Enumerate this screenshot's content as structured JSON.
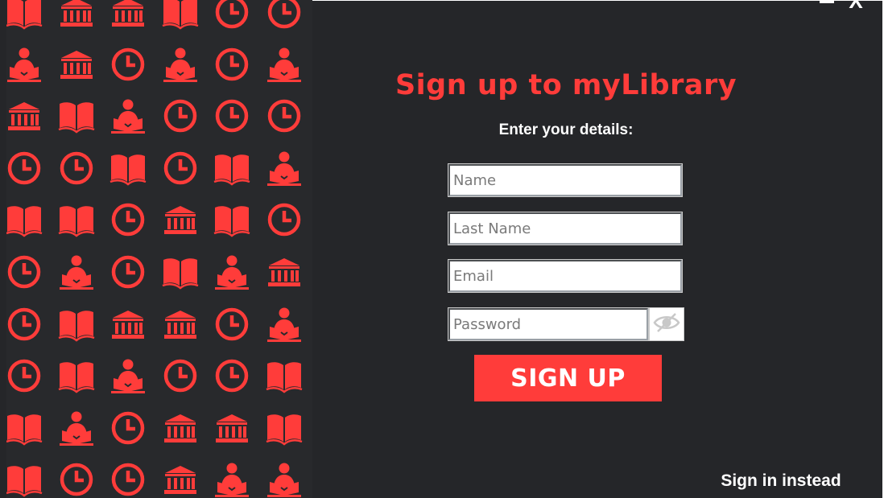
{
  "window": {
    "minimize_icon": "minimize-icon",
    "close_label": "X"
  },
  "colors": {
    "accent": "#ff3c3a",
    "background": "#252629",
    "text": "#ffffff"
  },
  "pattern": {
    "icon_names": [
      "book-icon",
      "library-building-icon",
      "clock-icon",
      "reader-icon"
    ],
    "rows": [
      [
        "book",
        "building",
        "building",
        "book",
        "clock",
        "clock"
      ],
      [
        "reader",
        "building",
        "clock",
        "reader",
        "clock",
        "reader"
      ],
      [
        "building",
        "book",
        "reader",
        "clock",
        "clock",
        "clock"
      ],
      [
        "clock",
        "clock",
        "book",
        "clock",
        "book",
        "reader"
      ],
      [
        "book",
        "book",
        "clock",
        "building",
        "book",
        "clock"
      ],
      [
        "clock",
        "reader",
        "clock",
        "book",
        "reader",
        "building"
      ],
      [
        "clock",
        "book",
        "building",
        "building",
        "clock",
        "reader"
      ],
      [
        "clock",
        "book",
        "reader",
        "clock",
        "clock",
        "book"
      ],
      [
        "book",
        "reader",
        "clock",
        "building",
        "building",
        "book"
      ],
      [
        "book",
        "clock",
        "clock",
        "building",
        "reader",
        "reader"
      ]
    ]
  },
  "form": {
    "title": "Sign up to myLibrary",
    "subtitle": "Enter your details:",
    "name_placeholder": "Name",
    "last_name_placeholder": "Last Name",
    "email_placeholder": "Email",
    "password_placeholder": "Password",
    "eye_icon": "eye-slash-icon",
    "submit_label": "SIGN UP",
    "signin_label": "Sign in instead"
  }
}
